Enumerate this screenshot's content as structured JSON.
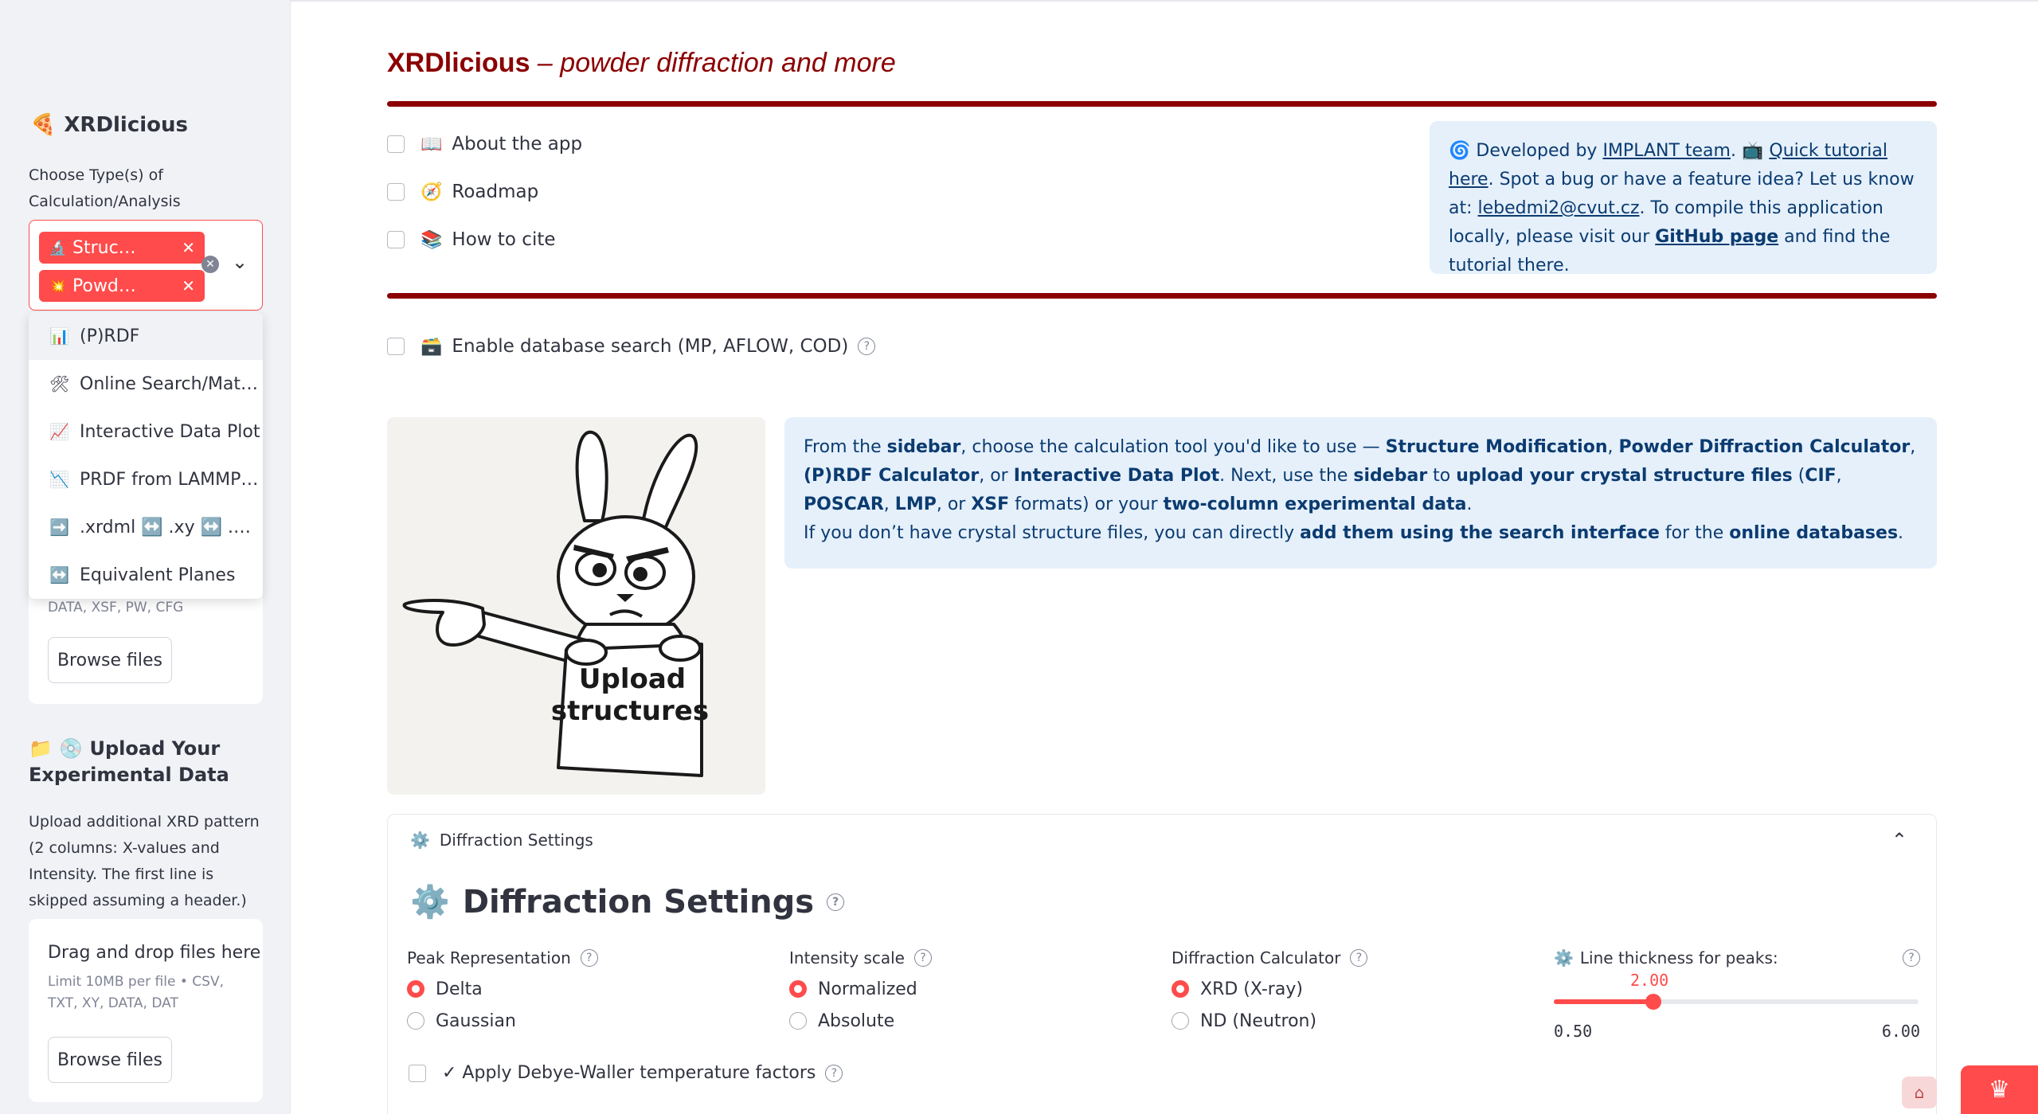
{
  "sidebar": {
    "app_title": "XRDlicious",
    "app_icon": "pizza-icon",
    "choose_label": "Choose Type(s) of Calculation/Analysis",
    "selected_chips": [
      {
        "label": "Struc…",
        "icon": "microscope-icon"
      },
      {
        "label": "Powd…",
        "icon": "sparkle-icon"
      }
    ],
    "dropdown_items": [
      {
        "label": "(P)RDF",
        "icon": "bar-chart-icon"
      },
      {
        "label": "Online Search/Mat…",
        "icon": "tools-icon"
      },
      {
        "label": "Interactive Data Plot",
        "icon": "line-chart-icon"
      },
      {
        "label": "PRDF from LAMMP…",
        "icon": "chart-down-icon"
      },
      {
        "label": ".xrdml ↔️ .xy ↔️ .…",
        "icon": "arrow-right-icon"
      },
      {
        "label": "Equivalent Planes",
        "icon": "left-right-arrow-icon"
      }
    ],
    "uploader1": {
      "limit_text": "DATA, XSF, PW, CFG",
      "browse_label": "Browse files"
    },
    "exp_header": "Upload Your Experimental Data",
    "exp_text": "Upload additional XRD pattern (2 columns: X-values and Intensity. The first line is skipped assuming a header.)",
    "uploader2": {
      "title": "Drag and drop files here",
      "limit_text": "Limit 10MB per file • CSV, TXT, XY, DATA, DAT",
      "browse_label": "Browse files"
    }
  },
  "main": {
    "title_main": "XRDlicious",
    "title_sub": " – powder diffraction and more",
    "checkboxes": [
      {
        "label": "About the app",
        "icon": "book-icon"
      },
      {
        "label": "Roadmap",
        "icon": "compass-icon"
      },
      {
        "label": "How to cite",
        "icon": "books-icon"
      }
    ],
    "info": {
      "dev_prefix": "Developed by",
      "team_link": "IMPLANT team",
      "tutorial_link": "Quick tutorial here",
      "bug_text": "Spot a bug or have a feature idea? Let us know at:",
      "email": "lebedmi2@cvut.cz",
      "compile_text": ". To compile this application locally, please visit our",
      "github_link": "GitHub page",
      "compile_tail": "and find the tutorial there."
    },
    "db_search_label": "Enable database search (MP, AFLOW, COD)",
    "illustration_text_1": "Upload",
    "illustration_text_2": "structures",
    "instructions": {
      "p1_a": "From the ",
      "sidebar": "sidebar",
      "p1_b": ", choose the calculation tool you'd like to use — ",
      "t1": "Structure Modification",
      "t2": "Powder Diffraction Calculator",
      "t3": "(P)RDF Calculator",
      "or": ", or ",
      "t4": "Interactive Data Plot",
      "p1_c": ". Next, use the ",
      "upload_bold": "upload your crystal structure files",
      "f1": "CIF",
      "f2": "POSCAR",
      "f3": "LMP",
      "f4": "XSF",
      "formats_tail": " formats) or your ",
      "two_col": "two-column experimental data",
      "p2_a": "If you don’t have crystal structure files, you can directly ",
      "p2_b": "add them using the search interface",
      "p2_c": " for the ",
      "p2_d": "online databases"
    },
    "expander": {
      "header": "Diffraction Settings",
      "section_title": "Diffraction Settings",
      "peak_label": "Peak Representation",
      "peak_options": [
        "Delta",
        "Gaussian"
      ],
      "peak_selected": "Delta",
      "intensity_label": "Intensity scale",
      "intensity_options": [
        "Normalized",
        "Absolute"
      ],
      "intensity_selected": "Normalized",
      "calc_label": "Diffraction Calculator",
      "calc_options": [
        "XRD (X-ray)",
        "ND (Neutron)"
      ],
      "calc_selected": "XRD (X-ray)",
      "slider_label": "Line thickness for peaks:",
      "slider_value": "2.00",
      "slider_min": "0.50",
      "slider_max": "6.00",
      "slider_fraction": 0.2727,
      "debye_label": "✓ Apply Debye-Waller temperature factors"
    }
  },
  "colors": {
    "accent": "#ff4b4b",
    "title": "#8b0000",
    "info_bg": "#e5f0fb",
    "info_text": "#0b3b70"
  }
}
